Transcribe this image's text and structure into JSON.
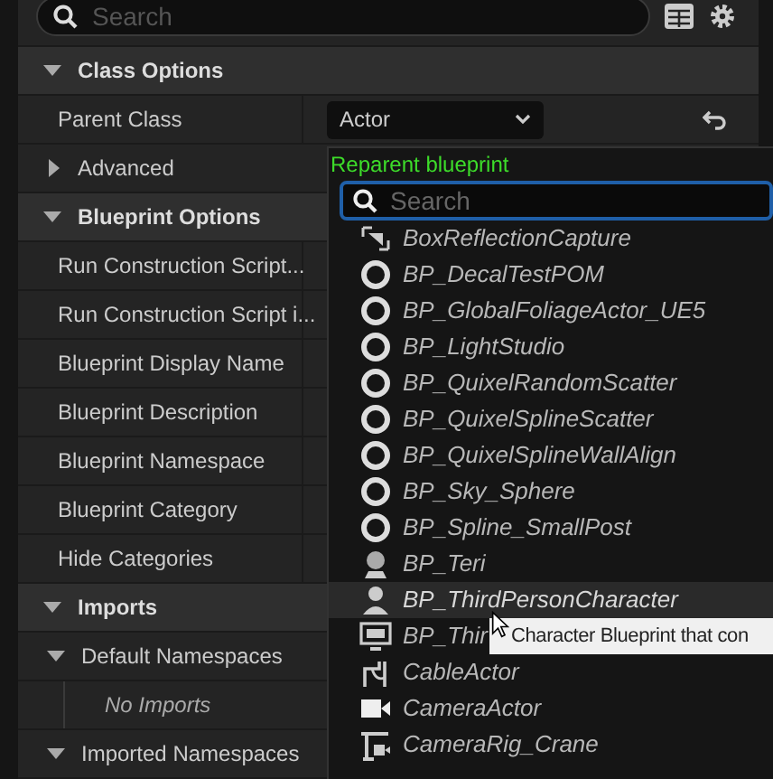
{
  "search": {
    "placeholder": "Search"
  },
  "sections": [
    {
      "title": "Class Options",
      "expanded": true,
      "rows": [
        {
          "kind": "property",
          "label": "Parent Class",
          "value": "Actor"
        },
        {
          "kind": "group",
          "label": "Advanced",
          "expanded": false
        }
      ]
    },
    {
      "title": "Blueprint Options",
      "expanded": true,
      "rows": [
        {
          "kind": "property",
          "label": "Run Construction Script..."
        },
        {
          "kind": "property",
          "label": "Run Construction Script i..."
        },
        {
          "kind": "property",
          "label": "Blueprint Display Name"
        },
        {
          "kind": "property",
          "label": "Blueprint Description"
        },
        {
          "kind": "property",
          "label": "Blueprint Namespace"
        },
        {
          "kind": "property",
          "label": "Blueprint Category"
        },
        {
          "kind": "property",
          "label": "Hide Categories"
        }
      ]
    },
    {
      "title": "Imports",
      "expanded": true,
      "rows": [
        {
          "kind": "group",
          "label": "Default Namespaces",
          "expanded": true
        },
        {
          "kind": "empty",
          "label": "No Imports"
        },
        {
          "kind": "group",
          "label": "Imported Namespaces",
          "expanded": true
        }
      ]
    }
  ],
  "reparent_menu": {
    "title": "Reparent blueprint",
    "search_placeholder": "Search",
    "items": [
      {
        "kind": "capture",
        "label": "BoxReflectionCapture",
        "selected": false
      },
      {
        "kind": "circle",
        "label": "BP_DecalTestPOM",
        "selected": false
      },
      {
        "kind": "circle",
        "label": "BP_GlobalFoliageActor_UE5",
        "selected": false
      },
      {
        "kind": "circle",
        "label": "BP_LightStudio",
        "selected": false
      },
      {
        "kind": "circle",
        "label": "BP_QuixelRandomScatter",
        "selected": false
      },
      {
        "kind": "circle",
        "label": "BP_QuixelSplineScatter",
        "selected": false
      },
      {
        "kind": "circle",
        "label": "BP_QuixelSplineWallAlign",
        "selected": false
      },
      {
        "kind": "circle",
        "label": "BP_Sky_Sphere",
        "selected": false
      },
      {
        "kind": "circle",
        "label": "BP_Spline_SmallPost",
        "selected": false
      },
      {
        "kind": "sphere",
        "label": "BP_Teri",
        "selected": false
      },
      {
        "kind": "person",
        "label": "BP_ThirdPersonCharacter",
        "selected": true
      },
      {
        "kind": "monitor",
        "label": "BP_Thir",
        "selected": false
      },
      {
        "kind": "cable",
        "label": "CableActor",
        "selected": false
      },
      {
        "kind": "camera",
        "label": "CameraActor",
        "selected": false
      },
      {
        "kind": "crane",
        "label": "CameraRig_Crane",
        "selected": false
      }
    ]
  },
  "tooltip": "Character Blueprint that con"
}
